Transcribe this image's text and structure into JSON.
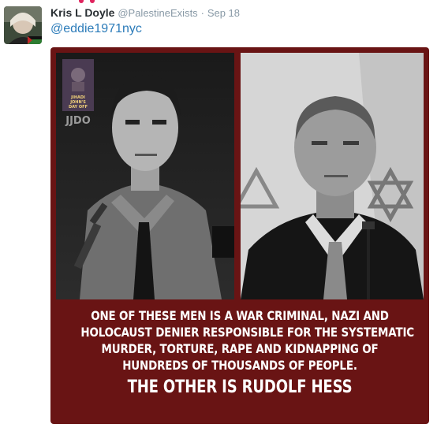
{
  "tweet": {
    "author_name": "Kris L Doyle",
    "author_handle": "@PalestineExists",
    "separator": "·",
    "timestamp": "Sep 18",
    "mention": "@eddie1971nyc",
    "avatar_icon": "user-avatar-photo"
  },
  "media": {
    "logo_text": "JJDO",
    "logo_subtext": [
      "JIHADI",
      "JOHN'S",
      "DAY OFF"
    ],
    "caption_lines": [
      "ONE OF THESE MEN IS A WAR CRIMINAL, NAZI AND",
      "HOLOCAUST DENIER RESPONSIBLE FOR THE SYSTEMATIC",
      "MURDER, TORTURE, RAPE AND KIDNAPPING OF",
      "HUNDREDS OF THOUSANDS OF PEOPLE."
    ],
    "caption_punchline": "THE OTHER IS RUDOLF HESS",
    "background_color": "#691414"
  },
  "colors": {
    "name": "#292f33",
    "meta": "#8899a6",
    "link": "#2b7bb9",
    "panel": "#691414"
  }
}
